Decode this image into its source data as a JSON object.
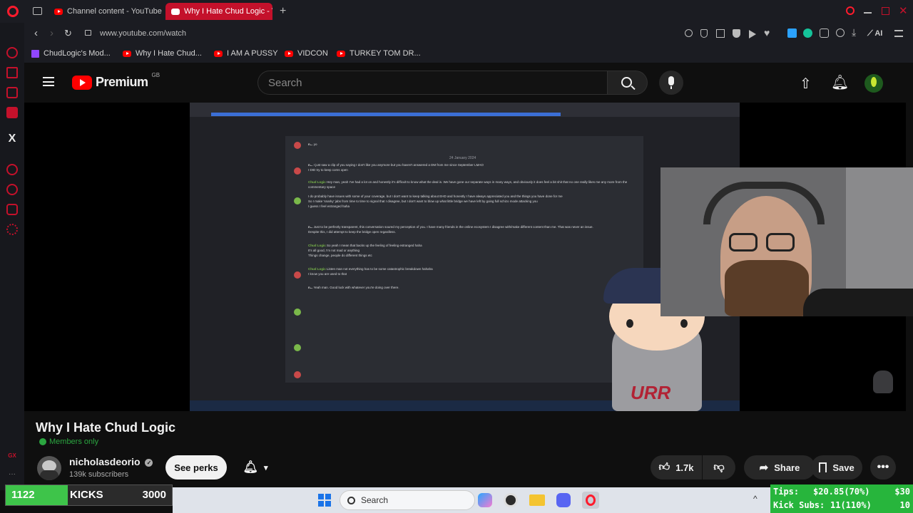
{
  "tabs": [
    {
      "label": "Channel content - YouTube"
    },
    {
      "label": "Why I Hate Chud Logic - YouTube"
    }
  ],
  "address": {
    "url": "www.youtube.com/watch"
  },
  "bookmarks": [
    {
      "label": "ChudLogic's Mod..."
    },
    {
      "label": "Why I Hate Chud..."
    },
    {
      "label": "I AM A PUSSY"
    },
    {
      "label": "VIDCON"
    },
    {
      "label": "TURKEY TOM DR..."
    }
  ],
  "browser_toolbar": {
    "ai_label": "AI"
  },
  "youtube": {
    "logo_text": "Premium",
    "region": "GB",
    "search_placeholder": "Search"
  },
  "video": {
    "title": "Why I Hate Chud Logic",
    "members_only": "Members only",
    "chat_date": "24 January 2024",
    "chat_messages": [
      {
        "author": "n...",
        "text": "yo"
      },
      {
        "author": "n...",
        "text": "I just saw a clip of you saying I don't like you anymore but you haven't answered a DM from me since September LMAO"
      },
      {
        "author": "n...",
        "text": "I DID try to keep coms open"
      },
      {
        "author": "Chud Logic",
        "text": "Hey man, yeah I've had a lot on and honestly it's difficult to know what the deal is. We have gone our separate ways in many ways, and obviously it does feel a bit shit that no one really likes me any more from the commentary space"
      },
      {
        "author": "Chud Logic",
        "text": "I do probably have issues with some of your coverage, but I don't want to keep talking about EHD and honestly I have always appreciated you and the things you have done for me"
      },
      {
        "author": "Chud Logic",
        "text": "So I make 'snarky' jabs from time to time to signal that I disagree, but I don't want to blow up what little bridge we have left by going full schizo mode attacking you"
      },
      {
        "author": "Chud Logic",
        "text": "I guess I feel estranged haha"
      },
      {
        "author": "n...",
        "text": "Just to be perfectly transparent, this conversation soured my perception of you. I have many friends in the online ecosystem I disagree with/make different content than me. That was never an issue."
      },
      {
        "author": "n...",
        "text": "Despite this, I did attempt to keep the bridge open regardless."
      },
      {
        "author": "Chud Logic",
        "text": "So yeah I mean that backs up the feeling of feeling estranged haha"
      },
      {
        "author": "Chud Logic",
        "text": "It's all good, I'm not mad or anything"
      },
      {
        "author": "Chud Logic",
        "text": "Things change, people do different things etc"
      },
      {
        "author": "Chud Logic",
        "text": "Listen man not everything has to be some catastrophic breakdown hahaha"
      },
      {
        "author": "Chud Logic",
        "text": "I know you are used to that"
      },
      {
        "author": "n...",
        "text": "Yeah man. Good luck with whatever you're doing over there."
      }
    ],
    "mascot_text": "URR"
  },
  "channel": {
    "name": "nicholasdeorio",
    "subscribers": "139k subscribers",
    "see_perks": "See perks"
  },
  "actions": {
    "likes": "1.7k",
    "share": "Share",
    "save": "Save"
  },
  "stream_overlay": {
    "kicks_current": "1122",
    "kicks_label": "KICKS",
    "kicks_goal": "3000",
    "kicks_progress": 0.374,
    "tips_label": "Tips:",
    "tips_value": "$20.85(70%)",
    "tips_goal": "$30",
    "subs_label": "Kick Subs:",
    "subs_value": "11(110%)",
    "subs_goal": "10"
  },
  "taskbar": {
    "search_label": "Search"
  },
  "colors": {
    "accent_red": "#c4112b",
    "yt_red": "#ff0000",
    "members_green": "#2ba640",
    "kicks_green": "#3ec44a",
    "tips_green": "#27b53c"
  }
}
